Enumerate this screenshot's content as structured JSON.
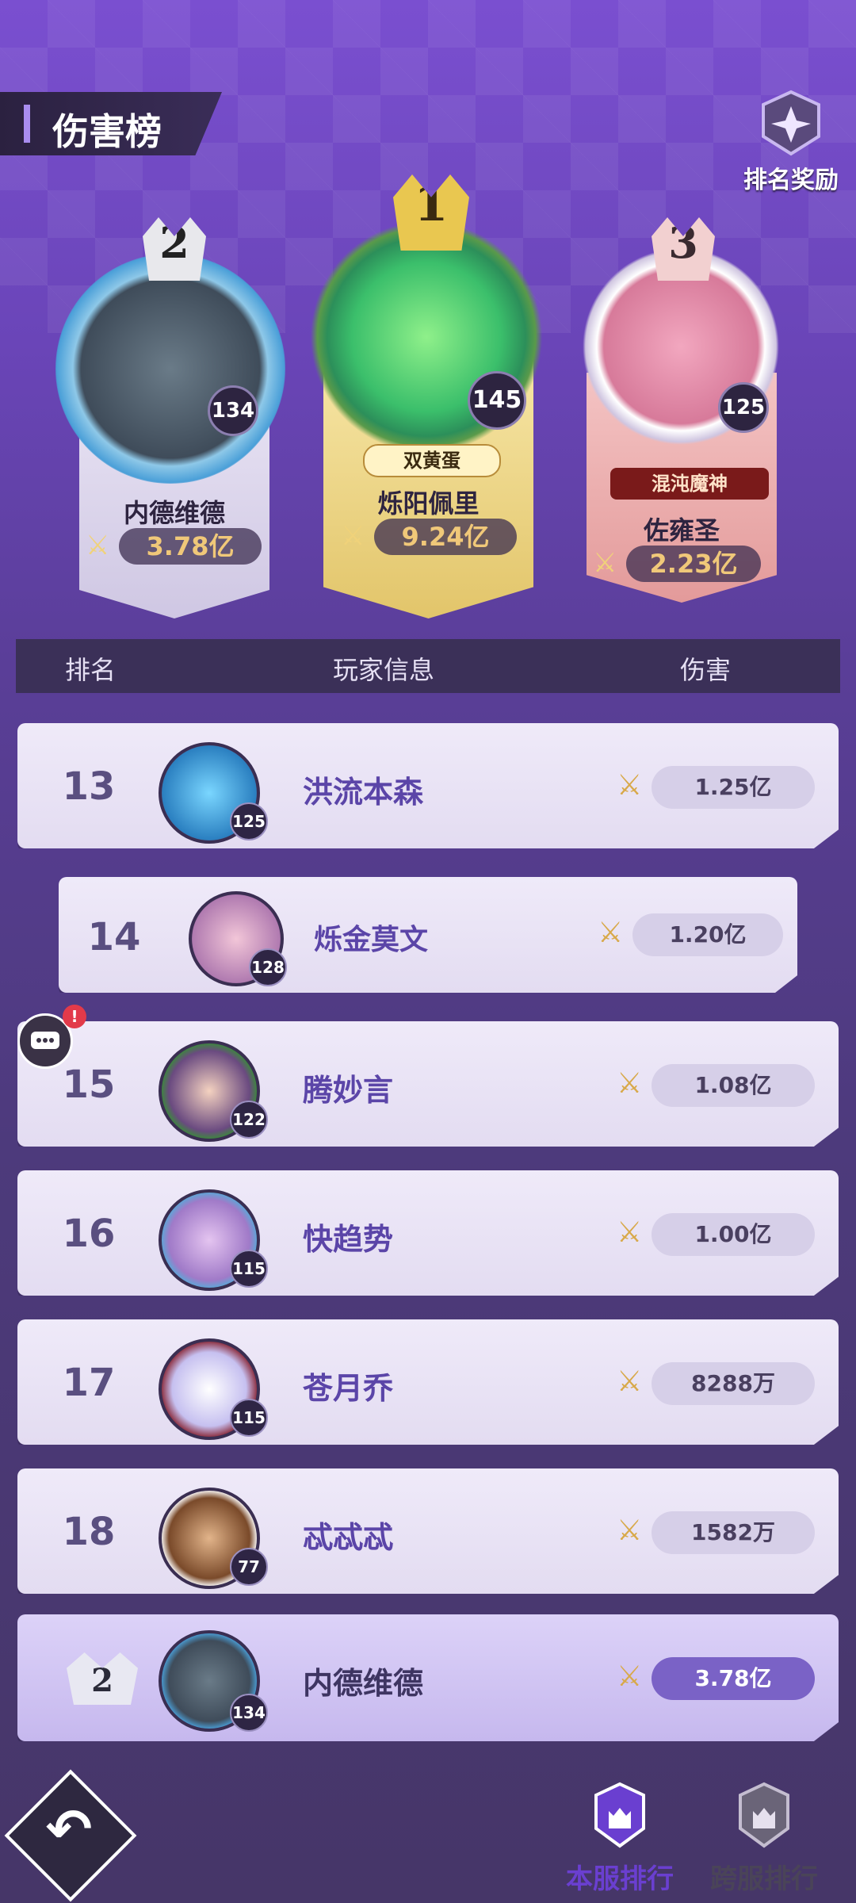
{
  "header": {
    "title": "伤害榜",
    "reward_label": "排名奖励"
  },
  "podium": [
    {
      "rank": "2",
      "level": "134",
      "name": "内德维德",
      "damage": "3.78亿"
    },
    {
      "rank": "1",
      "level": "145",
      "name": "烁阳佩里",
      "title_badge": "双黄蛋",
      "damage": "9.24亿"
    },
    {
      "rank": "3",
      "level": "125",
      "name": "佐雍圣",
      "title_badge": "混沌魔神",
      "damage": "2.23亿"
    }
  ],
  "table": {
    "headers": {
      "rank": "排名",
      "player": "玩家信息",
      "damage": "伤害"
    },
    "rows": [
      {
        "rank": "13",
        "level": "125",
        "name": "洪流本森",
        "damage": "1.25亿"
      },
      {
        "rank": "14",
        "level": "128",
        "name": "烁金莫文",
        "damage": "1.20亿"
      },
      {
        "rank": "15",
        "level": "122",
        "name": "腾妙言",
        "damage": "1.08亿"
      },
      {
        "rank": "16",
        "level": "115",
        "name": "快趋势",
        "damage": "1.00亿"
      },
      {
        "rank": "17",
        "level": "115",
        "name": "苍月乔",
        "damage": "8288万"
      },
      {
        "rank": "18",
        "level": "77",
        "name": "忒忒忒",
        "damage": "1582万"
      }
    ],
    "self_row": {
      "rank": "2",
      "level": "134",
      "name": "内德维德",
      "damage": "3.78亿"
    }
  },
  "chat": {
    "badge": "!"
  },
  "tabs": {
    "local": "本服排行",
    "cross": "跨服排行"
  },
  "colors": {
    "active_tab": "#6a3fd0",
    "inactive_tab": "#4a4458",
    "accent": "#a98df0"
  }
}
